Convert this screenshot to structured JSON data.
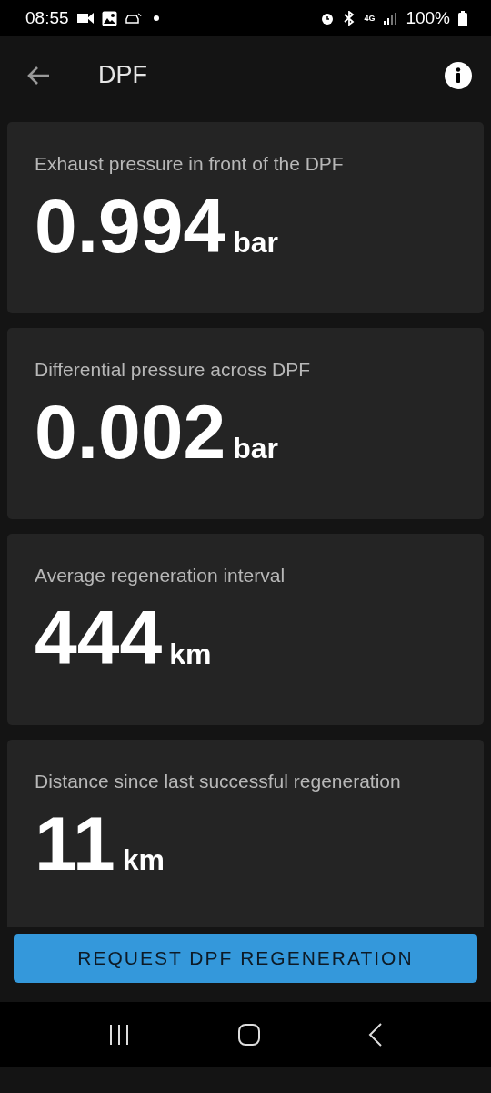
{
  "status_bar": {
    "time": "08:55",
    "network": "4G",
    "battery": "100%"
  },
  "app_bar": {
    "title": "DPF"
  },
  "metrics": [
    {
      "label": "Exhaust pressure in front of the DPF",
      "value": "0.994",
      "unit": "bar"
    },
    {
      "label": "Differential pressure across DPF",
      "value": "0.002",
      "unit": "bar"
    },
    {
      "label": "Average regeneration interval",
      "value": "444",
      "unit": "km"
    },
    {
      "label": "Distance since last successful regeneration",
      "value": "11",
      "unit": "km"
    }
  ],
  "action_button": {
    "label": "REQUEST DPF REGENERATION"
  }
}
